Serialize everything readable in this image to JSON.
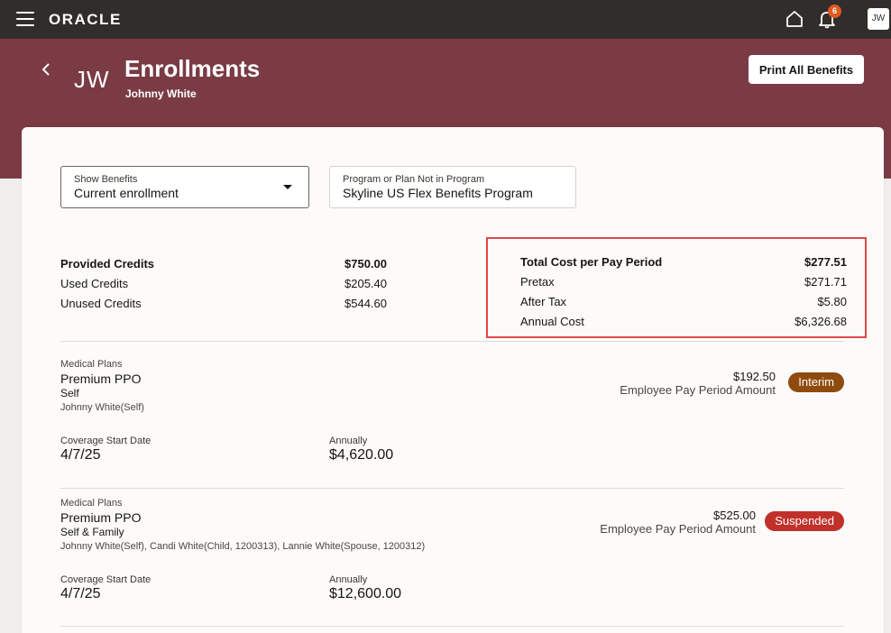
{
  "topbar": {
    "logo": "ORACLE",
    "notification_count": "6",
    "user_initials": "JW"
  },
  "header": {
    "initials": "JW",
    "title": "Enrollments",
    "subtitle": "Johnny White",
    "print_label": "Print All Benefits"
  },
  "filters": {
    "show_benefits_label": "Show Benefits",
    "show_benefits_value": "Current enrollment",
    "program_label": "Program or Plan Not in Program",
    "program_value": "Skyline US Flex Benefits Program"
  },
  "credits": {
    "rows": [
      {
        "label": "Provided Credits",
        "value": "$750.00"
      },
      {
        "label": "Used Credits",
        "value": "$205.40"
      },
      {
        "label": "Unused Credits",
        "value": "$544.60"
      }
    ]
  },
  "costs": {
    "rows": [
      {
        "label": "Total Cost per Pay Period",
        "value": "$277.51"
      },
      {
        "label": "Pretax",
        "value": "$271.71"
      },
      {
        "label": "After Tax",
        "value": "$5.80"
      },
      {
        "label": "Annual Cost",
        "value": "$6,326.68"
      }
    ]
  },
  "plans": [
    {
      "category": "Medical Plans",
      "name": "Premium PPO",
      "option": "Self",
      "participants": "Johnny White(Self)",
      "amount": "$192.50",
      "amount_label": "Employee Pay Period Amount",
      "status": "Interim",
      "coverage_label": "Coverage Start Date",
      "coverage_value": "4/7/25",
      "annual_label": "Annually",
      "annual_value": "$4,620.00"
    },
    {
      "category": "Medical Plans",
      "name": "Premium PPO",
      "option": "Self & Family",
      "participants": "Johnny White(Self), Candi White(Child, 1200313), Lannie White(Spouse, 1200312)",
      "amount": "$525.00",
      "amount_label": "Employee Pay Period Amount",
      "status": "Suspended",
      "coverage_label": "Coverage Start Date",
      "coverage_value": "4/7/25",
      "annual_label": "Annually",
      "annual_value": "$12,600.00"
    }
  ],
  "colors": {
    "topbar": "#312d2a",
    "header": "#7a3b45",
    "interim": "#8f4a0e",
    "suspended": "#c0312a",
    "highlight": "#e04848"
  }
}
